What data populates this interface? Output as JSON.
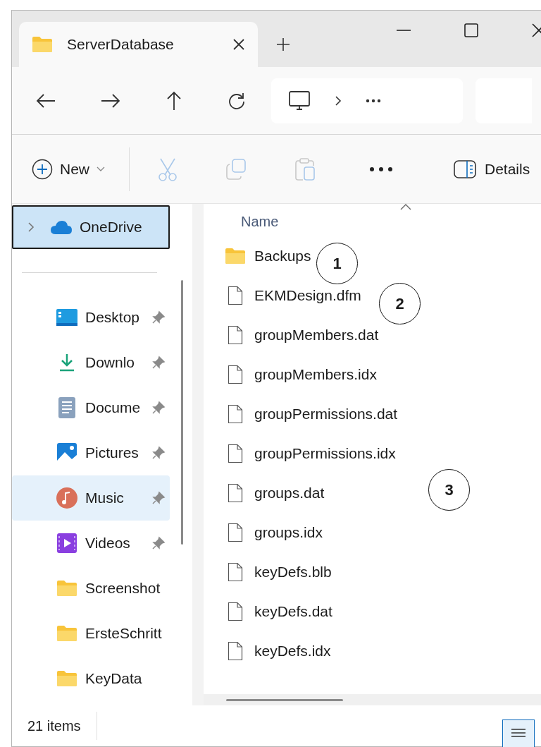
{
  "tab": {
    "title": "ServerDatabase",
    "selected": true
  },
  "toolbar": {
    "new_label": "New",
    "details_label": "Details"
  },
  "sidebar": {
    "top": {
      "label": "OneDrive",
      "selected": true
    },
    "items": [
      {
        "label": "Desktop",
        "kind": "desktop",
        "pinned": true,
        "selected": false
      },
      {
        "label": "Downlo",
        "kind": "downloads",
        "pinned": true,
        "selected": false
      },
      {
        "label": "Docume",
        "kind": "documents",
        "pinned": true,
        "selected": false
      },
      {
        "label": "Pictures",
        "kind": "pictures",
        "pinned": true,
        "selected": false
      },
      {
        "label": "Music",
        "kind": "music",
        "pinned": true,
        "selected": true
      },
      {
        "label": "Videos",
        "kind": "videos",
        "pinned": true,
        "selected": false
      },
      {
        "label": "Screenshot",
        "kind": "folder",
        "pinned": false,
        "selected": false
      },
      {
        "label": "ErsteSchritt",
        "kind": "folder",
        "pinned": false,
        "selected": false
      },
      {
        "label": "KeyData",
        "kind": "folder",
        "pinned": false,
        "selected": false
      }
    ]
  },
  "file_list": {
    "column": "Name",
    "rows": [
      {
        "name": "Backups",
        "kind": "folder"
      },
      {
        "name": "EKMDesign.dfm",
        "kind": "file"
      },
      {
        "name": "groupMembers.dat",
        "kind": "file"
      },
      {
        "name": "groupMembers.idx",
        "kind": "file"
      },
      {
        "name": "groupPermissions.dat",
        "kind": "file"
      },
      {
        "name": "groupPermissions.idx",
        "kind": "file"
      },
      {
        "name": "groups.dat",
        "kind": "file"
      },
      {
        "name": "groups.idx",
        "kind": "file"
      },
      {
        "name": "keyDefs.blb",
        "kind": "file"
      },
      {
        "name": "keyDefs.dat",
        "kind": "file"
      },
      {
        "name": "keyDefs.idx",
        "kind": "file"
      }
    ]
  },
  "callouts": [
    "1",
    "2",
    "3"
  ],
  "status_bar": {
    "count": "21 items"
  }
}
